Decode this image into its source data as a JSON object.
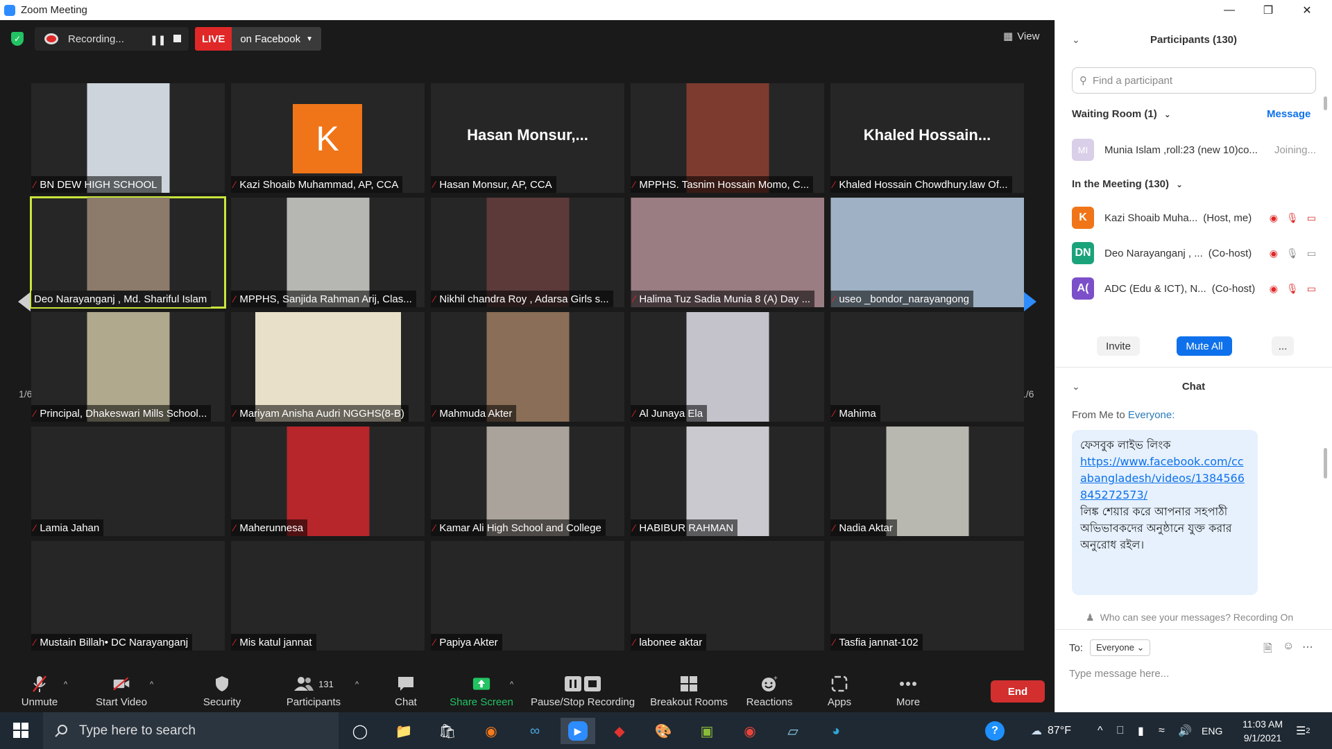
{
  "window": {
    "title": "Zoom Meeting"
  },
  "topbar": {
    "recording_label": "Recording...",
    "live_label": "LIVE",
    "live_destination": "on Facebook",
    "view_label": "View"
  },
  "grid": {
    "page_indicator": "1/6",
    "tiles": [
      {
        "name": "BN DEW HIGH SCHOOL",
        "kind": "video",
        "video_color": "#cdd4dc"
      },
      {
        "name": "Kazi Shoaib Muhammad, AP, CCA",
        "kind": "avatar",
        "avatar_letter": "K"
      },
      {
        "name": "Hasan Monsur, AP, CCA",
        "kind": "text",
        "big_text": "Hasan  Monsur,..."
      },
      {
        "name": "MPPHS.  Tasnim Hossain Momo, C...",
        "kind": "video",
        "video_color": "#7d3b2f"
      },
      {
        "name": "Khaled Hossain Chowdhury.law Of...",
        "kind": "text",
        "big_text": "Khaled  Hossain..."
      },
      {
        "name": "Deo Narayanganj , Md. Shariful Islam",
        "kind": "video",
        "video_color": "#8c7a6a",
        "active": true
      },
      {
        "name": "MPPHS, Sanjida Rahman Arij, Clas...",
        "kind": "video",
        "video_color": "#b6b6b2"
      },
      {
        "name": "Nikhil chandra Roy , Adarsa Girls s...",
        "kind": "video",
        "video_color": "#5c3a3a"
      },
      {
        "name": "Halima Tuz Sadia Munia 8 (A) Day ...",
        "kind": "video",
        "video_color": "#9a7c83",
        "wide": "full"
      },
      {
        "name": "useo _bondor_narayangong",
        "kind": "video",
        "video_color": "#9fb1c4",
        "wide": "full"
      },
      {
        "name": "Principal, Dhakeswari Mills School...",
        "kind": "video",
        "video_color": "#b0a98e"
      },
      {
        "name": "Mariyam Anisha Audri NGGHS(8-B)",
        "kind": "video",
        "video_color": "#e8e0c8",
        "wide": "wide"
      },
      {
        "name": "Mahmuda Akter",
        "kind": "video",
        "video_color": "#8a6e57"
      },
      {
        "name": "Al Junaya Ela",
        "kind": "video",
        "video_color": "#c4c3cc"
      },
      {
        "name": "Mahima",
        "kind": "blank"
      },
      {
        "name": "Lamia Jahan",
        "kind": "blank"
      },
      {
        "name": "Maherunnesa",
        "kind": "video",
        "video_color": "#b6262b"
      },
      {
        "name": "Kamar Ali High School and College",
        "kind": "video",
        "video_color": "#a9a39b"
      },
      {
        "name": "HABIBUR RAHMAN",
        "kind": "video",
        "video_color": "#c9c9cf"
      },
      {
        "name": "Nadia Aktar",
        "kind": "video",
        "video_color": "#b8b8b0"
      },
      {
        "name": "Mustain Billah• DC Narayanganj",
        "kind": "blank"
      },
      {
        "name": "Mis katul jannat",
        "kind": "blank"
      },
      {
        "name": "Papiya Akter",
        "kind": "blank"
      },
      {
        "name": "labonee aktar",
        "kind": "blank"
      },
      {
        "name": "Tasfia jannat-102",
        "kind": "blank"
      }
    ]
  },
  "toolbar": {
    "unmute": "Unmute",
    "start_video": "Start Video",
    "security": "Security",
    "participants": "Participants",
    "participants_count": "131",
    "chat": "Chat",
    "share_screen": "Share Screen",
    "pause_stop_recording": "Pause/Stop Recording",
    "breakout_rooms": "Breakout Rooms",
    "reactions": "Reactions",
    "apps": "Apps",
    "more": "More",
    "end": "End"
  },
  "participants_panel": {
    "title": "Participants (130)",
    "search_placeholder": "Find a participant",
    "waiting_room_label": "Waiting Room (1)",
    "message_label": "Message",
    "waiting": {
      "initials": "MI",
      "name": "Munia Islam ,roll:23 (new 10)co...",
      "status": "Joining..."
    },
    "in_meeting_label": "In the Meeting (130)",
    "members": [
      {
        "initials": "K",
        "name": "Kazi Shoaib Muha...",
        "role": "(Host, me)",
        "color": "#f07518"
      },
      {
        "initials": "DN",
        "name": "Deo Narayanganj , ...",
        "role": "(Co-host)",
        "color": "#1aa37a"
      },
      {
        "initials": "A(",
        "name": "ADC (Edu & ICT), N...",
        "role": "(Co-host)",
        "color": "#7b4fc9"
      }
    ],
    "invite": "Invite",
    "mute_all": "Mute All",
    "more_btn": "..."
  },
  "chat_panel": {
    "title": "Chat",
    "from_prefix": "From Me to ",
    "from_target": "Everyone:",
    "message_line1": "ফেসবুক লাইভ লিংক",
    "message_link": "https://www.facebook.com/ccabangladesh/videos/1384566845272573/",
    "message_line2": "লিঙ্ক শেয়ার করে আপনার সহপাঠী অভিভাবকদের অনুষ্ঠানে যুক্ত করার অনুরোধ রইল।",
    "who_can_see": "Who can see your messages? Recording On",
    "to_label": "To:",
    "to_value": "Everyone",
    "input_placeholder": "Type message here..."
  },
  "taskbar": {
    "search_placeholder": "Type here to search",
    "weather": "87°F",
    "language": "ENG",
    "time": "11:03 AM",
    "date": "9/1/2021",
    "notifications": "2"
  }
}
